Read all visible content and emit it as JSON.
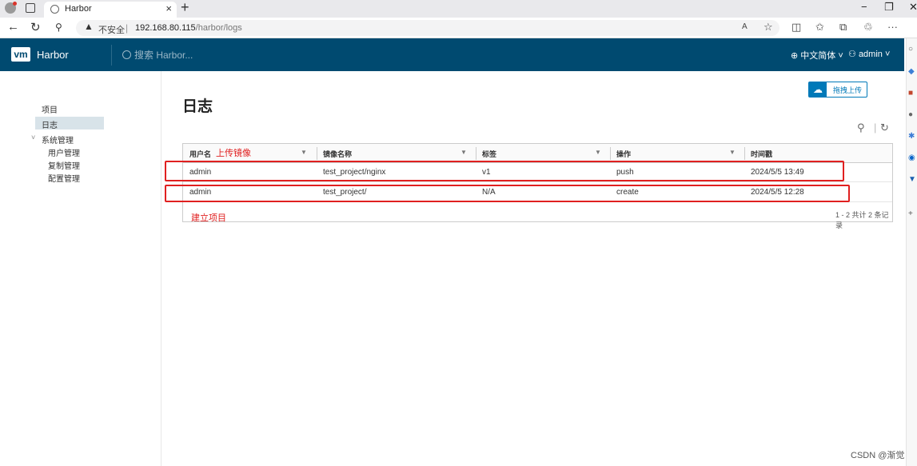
{
  "browser": {
    "tab_title": "Harbor",
    "close_glyph": "×",
    "new_tab_glyph": "+",
    "window_controls": [
      "−",
      "❐",
      "✕"
    ],
    "security_label": "不安全",
    "url_host": "192.168.80.115",
    "url_path": "/harbor/logs",
    "toolbar_icons": [
      "read-aloud-icon",
      "favorite-icon",
      "split-screen-icon",
      "favorites-icon",
      "collections-icon",
      "extensions-icon",
      "more-icon"
    ]
  },
  "header": {
    "logo_text": "vm",
    "brand": "Harbor",
    "search_placeholder": "搜索 Harbor...",
    "language": "中文简体",
    "user": "admin"
  },
  "sidebar": {
    "items": [
      {
        "label": "项目"
      },
      {
        "label": "日志"
      },
      {
        "label": "系统管理"
      },
      {
        "label": "用户管理"
      },
      {
        "label": "复制管理"
      },
      {
        "label": "配置管理"
      }
    ]
  },
  "main": {
    "title": "日志",
    "upload_label": "拖拽上传",
    "columns": [
      "用户名",
      "镜像名称",
      "标签",
      "操作",
      "时间戳"
    ],
    "rows": [
      {
        "user": "admin",
        "repo": "test_project/nginx",
        "tag": "v1",
        "operation": "push",
        "time": "2024/5/5 13:49"
      },
      {
        "user": "admin",
        "repo": "test_project/",
        "tag": "N/A",
        "operation": "create",
        "time": "2024/5/5 12:28"
      }
    ],
    "footer": "1 - 2 共计 2 条记录"
  },
  "annotations": {
    "upload_image": "上传镜像",
    "create_project": "建立项目",
    "color": "#e02020"
  },
  "watermark": "CSDN @渐觉"
}
